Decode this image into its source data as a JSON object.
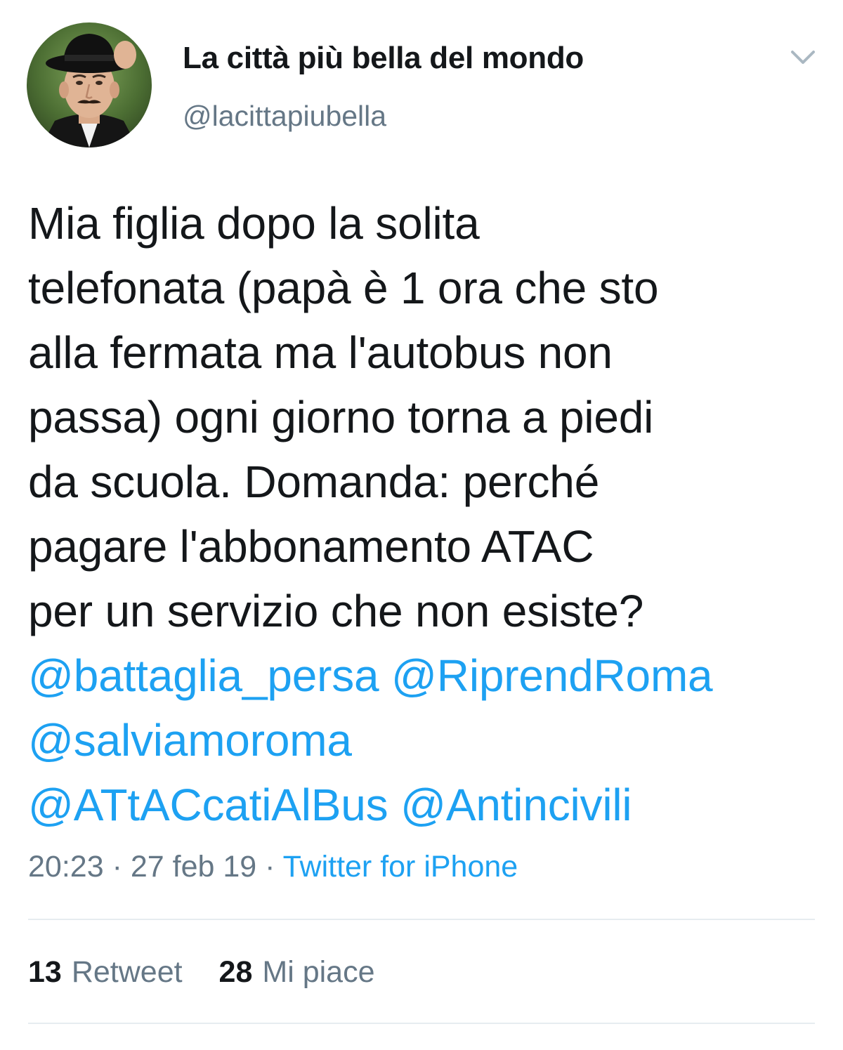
{
  "user": {
    "display_name": "La città più bella del mondo",
    "handle": "@lacittapiubella",
    "avatar_icon": "profile-photo-man-with-black-hat"
  },
  "menu": {
    "icon": "chevron-down-icon"
  },
  "tweet": {
    "lines": [
      "Mia figlia dopo la solita",
      "telefonata (papà è 1 ora che sto",
      "alla fermata ma l'autobus non",
      "passa) ogni giorno torna a piedi",
      "da scuola. Domanda: perché",
      "pagare l'abbonamento ATAC",
      "per un servizio che non esiste?"
    ],
    "mentions": [
      "@battaglia_persa",
      "@RiprendRoma",
      "@salviamoroma",
      "@ATtACcatiAlBus",
      "@Antincivili"
    ]
  },
  "meta": {
    "time": "20:23",
    "separator": "·",
    "date": "27 feb 19",
    "source": "Twitter for iPhone"
  },
  "stats": {
    "retweet_count": "13",
    "retweet_label": "Retweet",
    "like_count": "28",
    "like_label": "Mi piace"
  },
  "colors": {
    "text": "#14171a",
    "secondary": "#657786",
    "link": "#1da1f2",
    "divider": "#e6ecf0"
  }
}
